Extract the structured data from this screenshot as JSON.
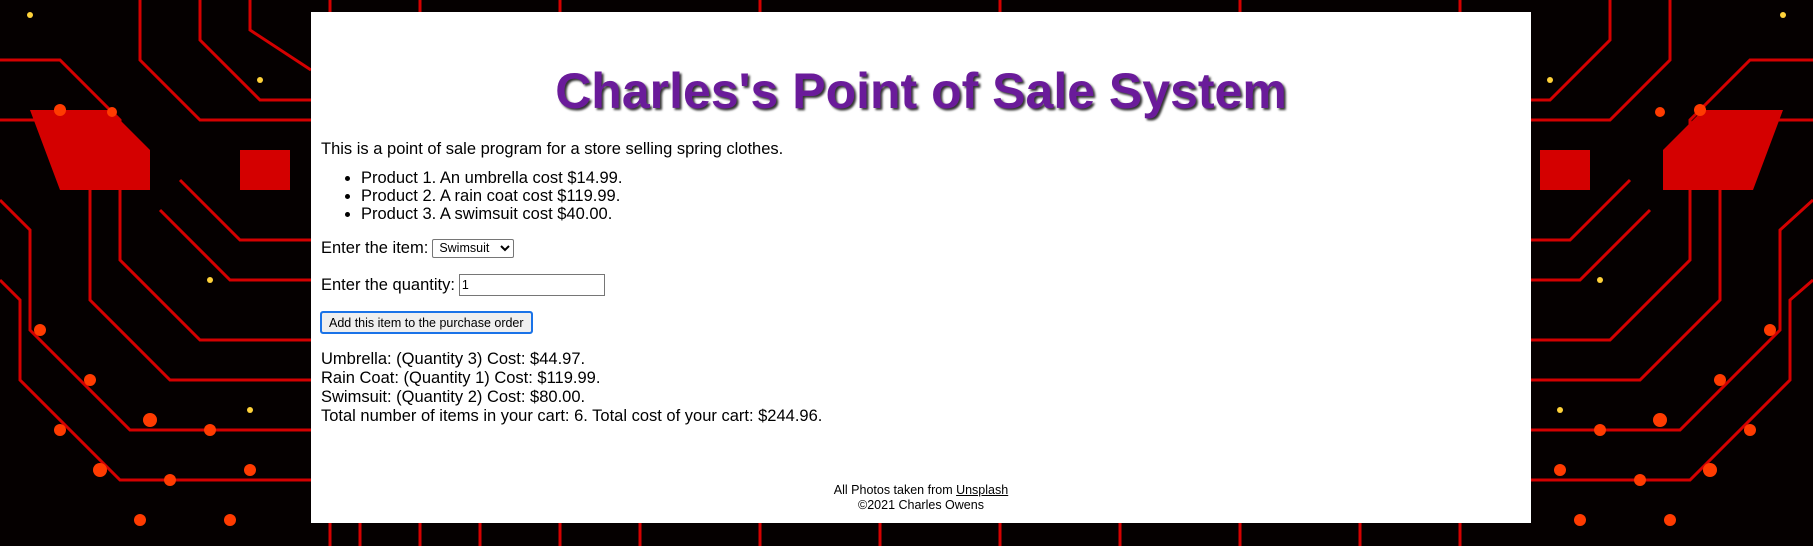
{
  "header": {
    "title": "Charles's Point of Sale System"
  },
  "intro": "This is a point of sale program for a store selling spring clothes.",
  "products": [
    "Product 1. An umbrella cost $14.99.",
    "Product 2. A rain coat cost $119.99.",
    "Product 3. A swimsuit cost $40.00."
  ],
  "form": {
    "item_label": "Enter the item:",
    "item_selected": "Swimsuit",
    "quantity_label": "Enter the quantity:",
    "quantity_value": "1",
    "add_button_label": "Add this item to the purchase order"
  },
  "order_lines": [
    "Umbrella: (Quantity 3) Cost: $44.97.",
    "Rain Coat: (Quantity 1) Cost: $119.99.",
    "Swimsuit: (Quantity 2) Cost: $80.00."
  ],
  "total_line": "Total number of items in your cart: 6. Total cost of your cart: $244.96.",
  "footer": {
    "credit_prefix": "All Photos taken from ",
    "credit_link": "Unsplash",
    "copyright": "©2021 Charles Owens"
  },
  "colors": {
    "title": "#6a1b9a",
    "background_circuit": "#e00000"
  }
}
